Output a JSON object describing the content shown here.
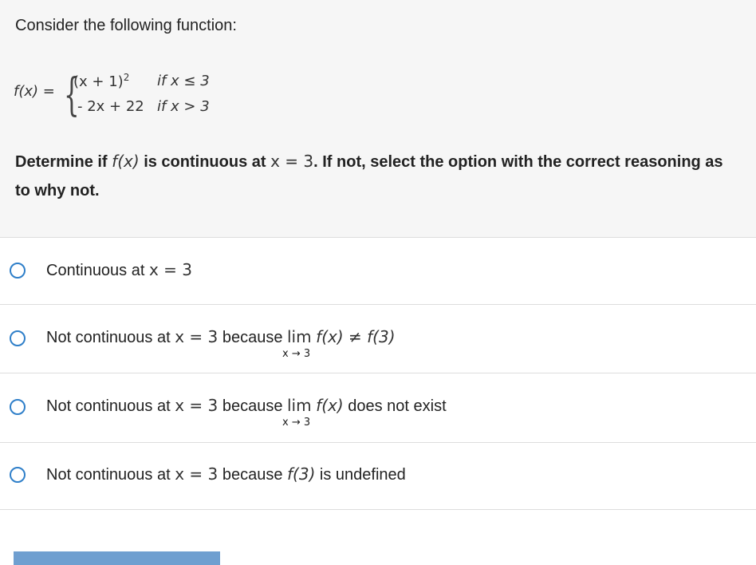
{
  "question": {
    "prompt": "Consider the following function:",
    "function": {
      "lhs": "f(x) =",
      "row1_expr": "(x + 1)",
      "row1_exp": "2",
      "row1_cond": "if x ≤ 3",
      "row2_expr": "- 2x + 22",
      "row2_cond": "if x > 3"
    },
    "determine": {
      "part1": "Determine if ",
      "fx": "f(x)",
      "part2": " is continuous at ",
      "xeq": "x = 3",
      "part3": ". If not, select the option with the correct reasoning as to why not."
    }
  },
  "options": [
    {
      "text": "Continuous at ",
      "math": "x = 3"
    },
    {
      "text": "Not continuous at ",
      "math": "x = 3",
      "because": " because ",
      "lim": "lim",
      "lim_sub": "x → 3",
      "expr": "f(x) ≠ f(3)"
    },
    {
      "text": "Not continuous at ",
      "math": "x = 3",
      "because": " because ",
      "lim": "lim",
      "lim_sub": "x → 3",
      "expr": "f(x)",
      "tail": " does not exist"
    },
    {
      "text": "Not continuous at ",
      "math": "x = 3",
      "because": " because ",
      "expr": "f(3)",
      "tail": " is undefined"
    }
  ],
  "colors": {
    "radio": "#2f7fc9",
    "submit": "#6f9fd0",
    "question_bg": "#f6f6f6"
  }
}
